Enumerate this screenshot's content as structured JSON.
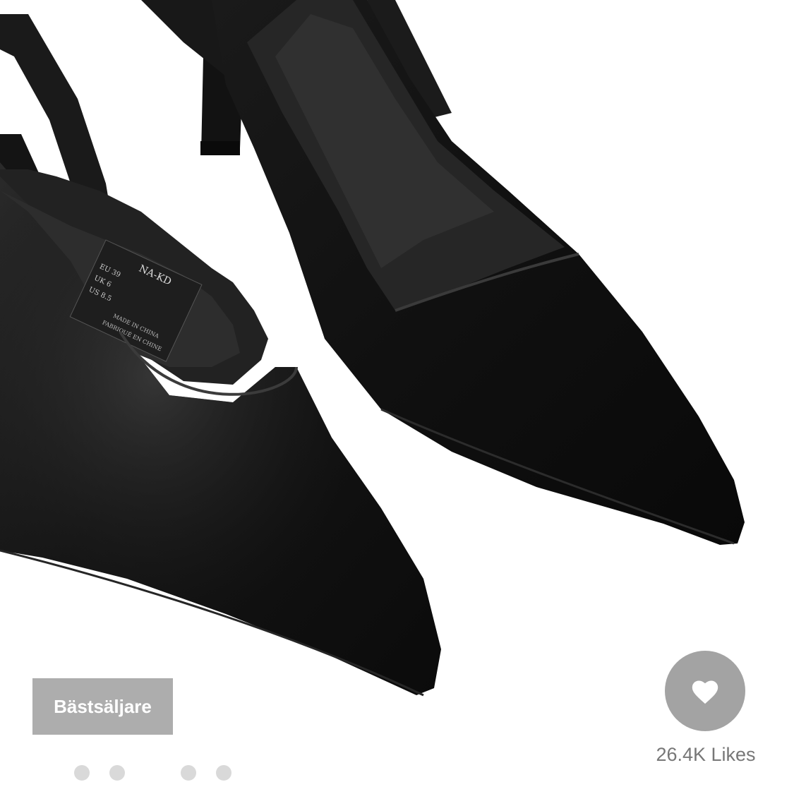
{
  "product_image": {
    "alt": "",
    "label_text": [
      "NA-KD",
      "EU 39",
      "UK 6",
      "US 8.5",
      "MADE IN CHINA",
      "FABRIQUÉ EN CHINE"
    ]
  },
  "badge": {
    "label": "Bästsäljare"
  },
  "likes": {
    "count_label": "26.4K Likes",
    "icon": "heart-icon"
  },
  "carousel": {
    "dot_count": 4,
    "active_index": null
  },
  "colors": {
    "badge_bg": "#adadad",
    "like_button_bg": "#a3a3a3",
    "likes_text": "#777777",
    "dot": "#d9d9d9",
    "shoe": "#111111"
  }
}
